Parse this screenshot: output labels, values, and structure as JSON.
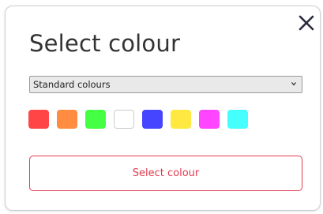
{
  "dialog": {
    "title": "Select colour",
    "close_icon": "close-icon",
    "colour_set": {
      "selected": "Standard colours"
    },
    "swatches": [
      {
        "color": "#ff4545"
      },
      {
        "color": "#ff8c40"
      },
      {
        "color": "#45ff45"
      },
      {
        "color": "#ffffff"
      },
      {
        "color": "#4545ff"
      },
      {
        "color": "#ffe840"
      },
      {
        "color": "#ff45ff"
      },
      {
        "color": "#45ffff"
      }
    ],
    "action": {
      "label": "Select colour"
    },
    "accent_color": "#e03a4d",
    "title_color": "#333333",
    "close_color": "#2b2d3d"
  }
}
